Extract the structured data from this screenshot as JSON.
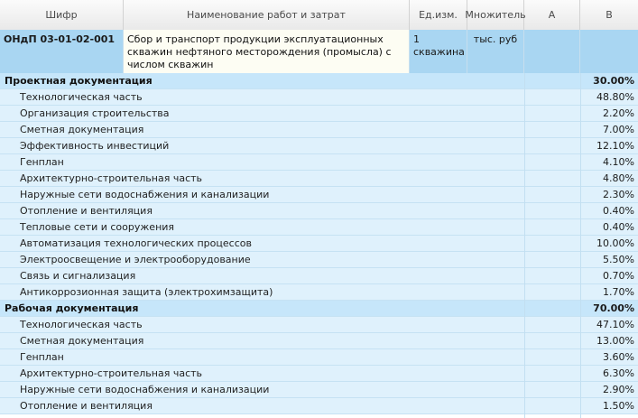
{
  "header": {
    "col_code": "Шифр",
    "col_name": "Наименование работ и затрат",
    "col_unit": "Ед.изм.",
    "col_mult": "Множитель",
    "col_a": "А",
    "col_b": "В"
  },
  "record": {
    "code": "ОНдП 03-01-02-001",
    "name": "Сбор и транспорт продукции эксплуатационных скважин нефтяного месторождения (промысла) с числом скважин",
    "unit": "1 скважина",
    "mult": "тыс. руб"
  },
  "rows": [
    {
      "type": "sec",
      "label": "Проектная документация",
      "value": "30.00%"
    },
    {
      "type": "item",
      "label": "Технологическая часть",
      "value": "48.80%"
    },
    {
      "type": "item",
      "label": "Организация строительства",
      "value": "2.20%"
    },
    {
      "type": "item",
      "label": "Сметная документация",
      "value": "7.00%"
    },
    {
      "type": "item",
      "label": "Эффективность инвестиций",
      "value": "12.10%"
    },
    {
      "type": "item",
      "label": "Генплан",
      "value": "4.10%"
    },
    {
      "type": "item",
      "label": "Архитектурно-строительная часть",
      "value": "4.80%"
    },
    {
      "type": "item",
      "label": "Наружные сети водоснабжения и канализации",
      "value": "2.30%"
    },
    {
      "type": "item",
      "label": "Отопление и вентиляция",
      "value": "0.40%"
    },
    {
      "type": "item",
      "label": "Тепловые сети и сооружения",
      "value": "0.40%"
    },
    {
      "type": "item",
      "label": "Автоматизация технологических процессов",
      "value": "10.00%"
    },
    {
      "type": "item",
      "label": "Электроосвещение и электрооборудование",
      "value": "5.50%"
    },
    {
      "type": "item",
      "label": "Связь и сигнализация",
      "value": "0.70%"
    },
    {
      "type": "item",
      "label": "Антикоррозионная защита (электрохимзащита)",
      "value": "1.70%"
    },
    {
      "type": "sec",
      "label": "Рабочая документация",
      "value": "70.00%"
    },
    {
      "type": "item",
      "label": "Технологическая часть",
      "value": "47.10%"
    },
    {
      "type": "item",
      "label": "Сметная документация",
      "value": "13.00%"
    },
    {
      "type": "item",
      "label": "Генплан",
      "value": "3.60%"
    },
    {
      "type": "item",
      "label": "Архитектурно-строительная часть",
      "value": "6.30%"
    },
    {
      "type": "item",
      "label": "Наружные сети водоснабжения и канализации",
      "value": "2.90%"
    },
    {
      "type": "item",
      "label": "Отопление и вентиляция",
      "value": "1.50%"
    }
  ]
}
